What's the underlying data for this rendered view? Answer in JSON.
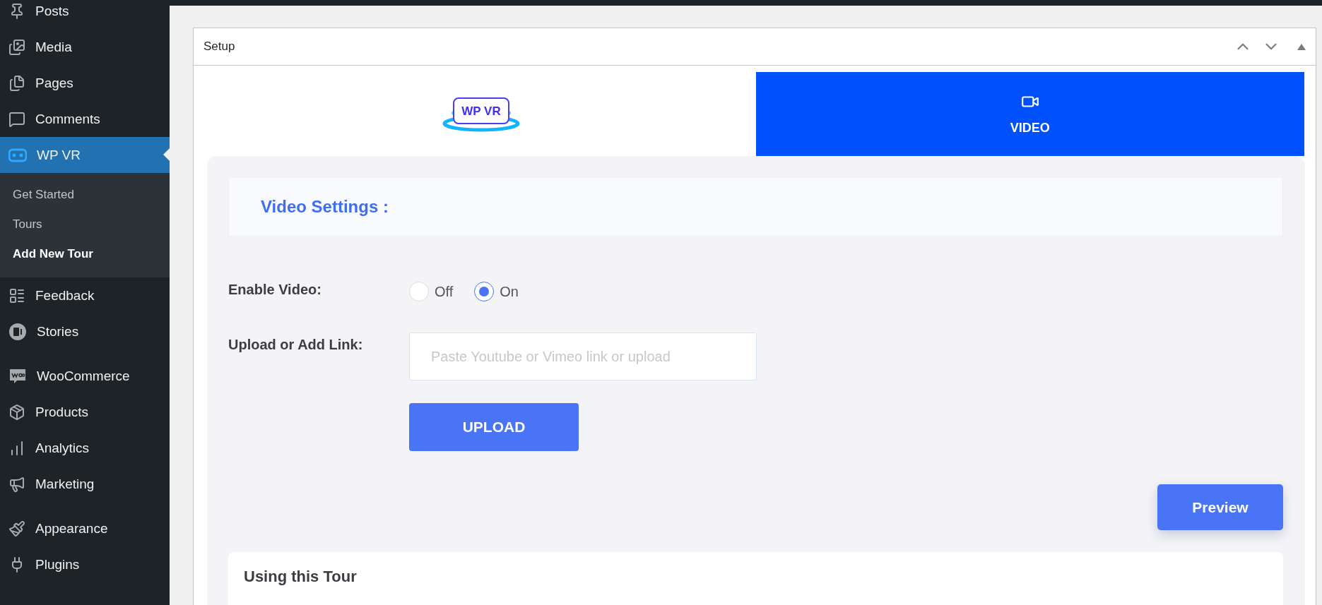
{
  "sidebar": {
    "sections": [
      {
        "items": [
          {
            "label": "Posts",
            "selected": false
          },
          {
            "label": "Media",
            "selected": false
          },
          {
            "label": "Pages",
            "selected": false
          },
          {
            "label": "Comments",
            "selected": false
          },
          {
            "label": "WP VR",
            "selected": true,
            "children": [
              {
                "label": "Get Started",
                "selected": false
              },
              {
                "label": "Tours",
                "selected": false
              },
              {
                "label": "Add New Tour",
                "selected": true
              }
            ]
          },
          {
            "label": "Feedback",
            "selected": false
          },
          {
            "label": "Stories",
            "selected": false
          }
        ]
      },
      {
        "items": [
          {
            "label": "WooCommerce",
            "selected": false
          },
          {
            "label": "Products",
            "selected": false
          },
          {
            "label": "Analytics",
            "selected": false
          },
          {
            "label": "Marketing",
            "selected": false
          }
        ]
      },
      {
        "items": [
          {
            "label": "Appearance",
            "selected": false
          },
          {
            "label": "Plugins",
            "selected": false
          }
        ]
      }
    ]
  },
  "postbox": {
    "title": "Setup",
    "tabs": [
      {
        "kind": "logo",
        "label": "WP VR",
        "selected": false
      },
      {
        "kind": "video",
        "label": "VIDEO",
        "selected": true
      }
    ],
    "section_title": "Video Settings :",
    "fields": [
      {
        "kind": "radio",
        "label": "Enable Video:",
        "options": [
          {
            "label": "Off",
            "selected": false
          },
          {
            "label": "On",
            "selected": true
          }
        ]
      },
      {
        "kind": "link",
        "label": "Upload or Add Link:",
        "placeholder": "Paste Youtube or Vimeo link or upload",
        "button": "UPLOAD"
      }
    ],
    "preview_button": "Preview",
    "card_title": "Using this Tour"
  }
}
